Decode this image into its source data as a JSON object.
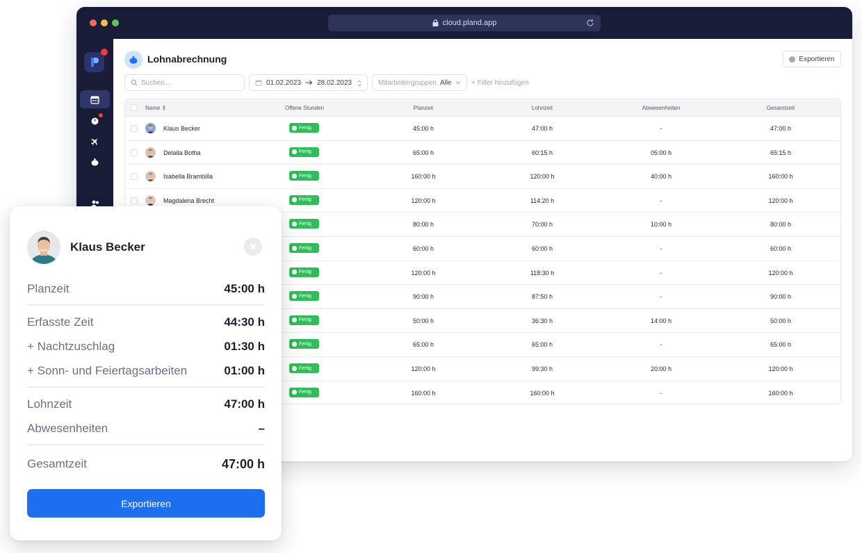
{
  "browser": {
    "url": "cloud.pland.app"
  },
  "page": {
    "title": "Lohnabrechnung",
    "export_label": "Exportieren"
  },
  "filters": {
    "search_placeholder": "Suchen...",
    "date_from": "01.02.2023",
    "date_to": "28.02.2023",
    "group_label": "Mitarbeitergruppen",
    "group_value": "Alle",
    "add_filter": "+ Filter hinzufügen"
  },
  "table": {
    "headers": [
      "Name",
      "Offene Stunden",
      "Planzeit",
      "Lohnzeit",
      "Abwesenheiten",
      "Gesamtzeit"
    ],
    "status_label": "Fertig",
    "rows": [
      {
        "name": "Klaus Becker",
        "plan": "45:00 h",
        "lohn": "47:00 h",
        "abw": "-",
        "ges": "47:00 h"
      },
      {
        "name": "Delaila Botha",
        "plan": "65:00 h",
        "lohn": "60:15 h",
        "abw": "05:00 h",
        "ges": "65:15 h"
      },
      {
        "name": "Isabella Brambilla",
        "plan": "160:00 h",
        "lohn": "120:00 h",
        "abw": "40:00 h",
        "ges": "160:00 h"
      },
      {
        "name": "Magdalena Brecht",
        "plan": "120:00 h",
        "lohn": "114:20 h",
        "abw": "-",
        "ges": "120:00 h"
      },
      {
        "name": "",
        "plan": "80:00 h",
        "lohn": "70:00 h",
        "abw": "10:00 h",
        "ges": "80:00 h"
      },
      {
        "name": "",
        "plan": "60:00 h",
        "lohn": "60:00 h",
        "abw": "-",
        "ges": "60:00 h"
      },
      {
        "name": "",
        "plan": "120:00 h",
        "lohn": "118:30 h",
        "abw": "-",
        "ges": "120:00 h"
      },
      {
        "name": "",
        "plan": "90:00 h",
        "lohn": "87:50 h",
        "abw": "-",
        "ges": "90:00 h"
      },
      {
        "name": "",
        "plan": "50:00 h",
        "lohn": "36:30 h",
        "abw": "14:00 h",
        "ges": "50:00 h"
      },
      {
        "name": "",
        "plan": "65:00 h",
        "lohn": "65:00 h",
        "abw": "-",
        "ges": "65:00 h"
      },
      {
        "name": "",
        "plan": "120:00 h",
        "lohn": "99:30 h",
        "abw": "20:00 h",
        "ges": "120:00 h"
      },
      {
        "name": "",
        "plan": "160:00 h",
        "lohn": "160:00 h",
        "abw": "-",
        "ges": "160:00 h"
      }
    ]
  },
  "detail": {
    "employee": "Klaus Becker",
    "lines": [
      {
        "label": "Planzeit",
        "value": "45:00 h"
      },
      {
        "label": "Erfasste Zeit",
        "value": "44:30 h"
      },
      {
        "label": "+ Nachtzuschlag",
        "value": "01:30 h"
      },
      {
        "label": "+ Sonn- und Feiertagsarbeiten",
        "value": "01:00 h"
      },
      {
        "label": "Lohnzeit",
        "value": "47:00 h"
      },
      {
        "label": "Abwesenheiten",
        "value": "–"
      },
      {
        "label": "Gesamtzeit",
        "value": "47:00 h"
      }
    ],
    "export_label": "Exportieren"
  },
  "colors": {
    "sidebar": "#181c36",
    "accent": "#1e6ff0",
    "status_green": "#2ebd59",
    "notification": "#ef3b3b"
  }
}
